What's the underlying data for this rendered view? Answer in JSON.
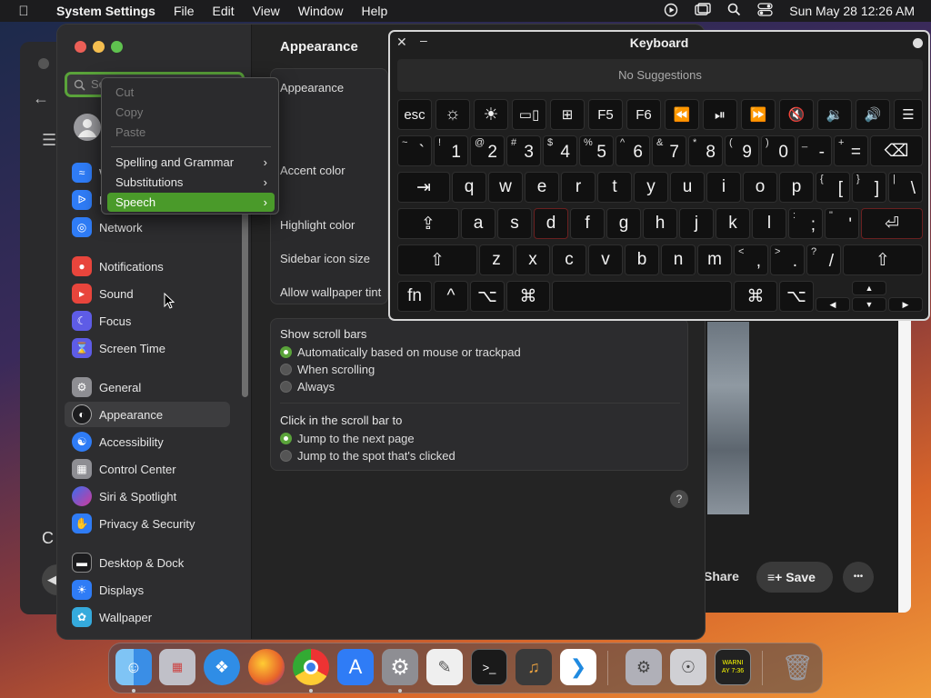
{
  "menubar": {
    "app": "System Settings",
    "items": [
      "File",
      "Edit",
      "View",
      "Window",
      "Help"
    ],
    "clock": "Sun May 28  12:26 AM"
  },
  "settings": {
    "search_placeholder": "Se",
    "sidebar": [
      {
        "label": "W",
        "icon": "wifi-icon",
        "color": "#2f7cf6"
      },
      {
        "label": "B",
        "icon": "bluetooth-icon",
        "color": "#2f7cf6"
      },
      {
        "label": "Network",
        "icon": "globe-icon",
        "color": "#2f7cf6"
      },
      {
        "label": "Notifications",
        "icon": "bell-icon",
        "color": "#e8453c"
      },
      {
        "label": "Sound",
        "icon": "speaker-icon",
        "color": "#e8453c"
      },
      {
        "label": "Focus",
        "icon": "moon-icon",
        "color": "#5e5ce6"
      },
      {
        "label": "Screen Time",
        "icon": "hourglass-icon",
        "color": "#5e5ce6"
      },
      {
        "label": "General",
        "icon": "gear-icon",
        "color": "#8e8e93"
      },
      {
        "label": "Appearance",
        "icon": "appearance-icon",
        "color": "#1c1c1e"
      },
      {
        "label": "Accessibility",
        "icon": "accessibility-icon",
        "color": "#2f7cf6"
      },
      {
        "label": "Control Center",
        "icon": "control-center-icon",
        "color": "#8e8e93"
      },
      {
        "label": "Siri & Spotlight",
        "icon": "siri-icon",
        "color": "#7a4ad8"
      },
      {
        "label": "Privacy & Security",
        "icon": "hand-icon",
        "color": "#2f7cf6"
      },
      {
        "label": "Desktop & Dock",
        "icon": "dock-icon",
        "color": "#1c1c1e"
      },
      {
        "label": "Displays",
        "icon": "sun-icon",
        "color": "#2f7cf6"
      },
      {
        "label": "Wallpaper",
        "icon": "wallpaper-icon",
        "color": "#35aadc"
      }
    ],
    "content": {
      "title": "Appearance",
      "rows": [
        "Appearance",
        "Accent color",
        "Highlight color",
        "Sidebar icon size",
        "Allow wallpaper tint"
      ],
      "scroll_title": "Show scroll bars",
      "scroll_options": [
        "Automatically based on mouse or trackpad",
        "When scrolling",
        "Always"
      ],
      "click_title": "Click in the scroll bar to",
      "click_options": [
        "Jump to the next page",
        "Jump to the spot that's clicked"
      ],
      "help": "?"
    }
  },
  "context_menu": {
    "items": [
      "Cut",
      "Copy",
      "Paste",
      "Spelling and Grammar",
      "Substitutions",
      "Speech"
    ],
    "highlighted": "Speech"
  },
  "keyboard": {
    "title": "Keyboard",
    "suggestions": "No Suggestions",
    "fn_row": [
      "esc",
      "☼",
      "☀",
      "▭▯",
      "⊞",
      "F5",
      "F6",
      "⏪",
      "⏯",
      "⏩",
      "🔇",
      "🔉",
      "🔊",
      "☰"
    ],
    "num_row": [
      {
        "s": "~",
        "m": "`"
      },
      {
        "s": "!",
        "m": "1"
      },
      {
        "s": "@",
        "m": "2"
      },
      {
        "s": "#",
        "m": "3"
      },
      {
        "s": "$",
        "m": "4"
      },
      {
        "s": "%",
        "m": "5"
      },
      {
        "s": "^",
        "m": "6"
      },
      {
        "s": "&",
        "m": "7"
      },
      {
        "s": "*",
        "m": "8"
      },
      {
        "s": "(",
        "m": "9"
      },
      {
        "s": ")",
        "m": "0"
      },
      {
        "s": "_",
        "m": "-"
      },
      {
        "s": "+",
        "m": "="
      }
    ],
    "delete": "⌫",
    "tab": "⇥",
    "q_row": [
      "q",
      "w",
      "e",
      "r",
      "t",
      "y",
      "u",
      "i",
      "o",
      "p"
    ],
    "q_row_sym": [
      {
        "s": "{",
        "m": "["
      },
      {
        "s": "}",
        "m": "]"
      },
      {
        "s": "|",
        "m": "\\"
      }
    ],
    "caps": "⇪",
    "a_row": [
      "a",
      "s",
      "d",
      "f",
      "g",
      "h",
      "j",
      "k",
      "l"
    ],
    "a_row_sym": [
      {
        "s": ":",
        "m": ";"
      },
      {
        "s": "\"",
        "m": "'"
      }
    ],
    "return": "⏎",
    "shift": "⇧",
    "z_row": [
      "z",
      "x",
      "c",
      "v",
      "b",
      "n",
      "m"
    ],
    "z_row_sym": [
      {
        "s": "<",
        "m": ","
      },
      {
        "s": ">",
        "m": "."
      },
      {
        "s": "?",
        "m": "/"
      }
    ],
    "bottom": {
      "fn": "fn",
      "ctrl": "^",
      "opt": "⌥",
      "cmd": "⌘"
    },
    "arrows": {
      "up": "▲",
      "left": "◀",
      "down": "▼",
      "right": "▶"
    }
  },
  "bg": {
    "left_char": "C",
    "share": "Share",
    "save": "Save",
    "more": "•••"
  },
  "dock": {
    "items": [
      {
        "name": "finder-icon",
        "color": "#3a8ee6"
      },
      {
        "name": "launchpad-icon",
        "color": "#c0c0c8"
      },
      {
        "name": "safari-icon",
        "color": "#2f8de6"
      },
      {
        "name": "firefox-icon",
        "color": "#e8642a"
      },
      {
        "name": "chrome-icon",
        "color": "#e0e0e0"
      },
      {
        "name": "app-store-icon",
        "color": "#2f7cf6"
      },
      {
        "name": "system-settings-icon",
        "color": "#8e8e93"
      },
      {
        "name": "textedit-icon",
        "color": "#efefef"
      },
      {
        "name": "terminal-icon",
        "color": "#1a1a1a"
      },
      {
        "name": "garageband-icon",
        "color": "#3a3a3a"
      },
      {
        "name": "vscode-icon",
        "color": "#1f8ae0"
      },
      {
        "name": "disk-utility-icon",
        "color": "#b0b0b8"
      },
      {
        "name": "system-info-icon",
        "color": "#d0d0d4"
      },
      {
        "name": "console-icon",
        "color": "#222"
      },
      {
        "name": "trash-icon",
        "color": "#8a8a90"
      }
    ],
    "console_text": "WARNI\nAY 7:36"
  }
}
